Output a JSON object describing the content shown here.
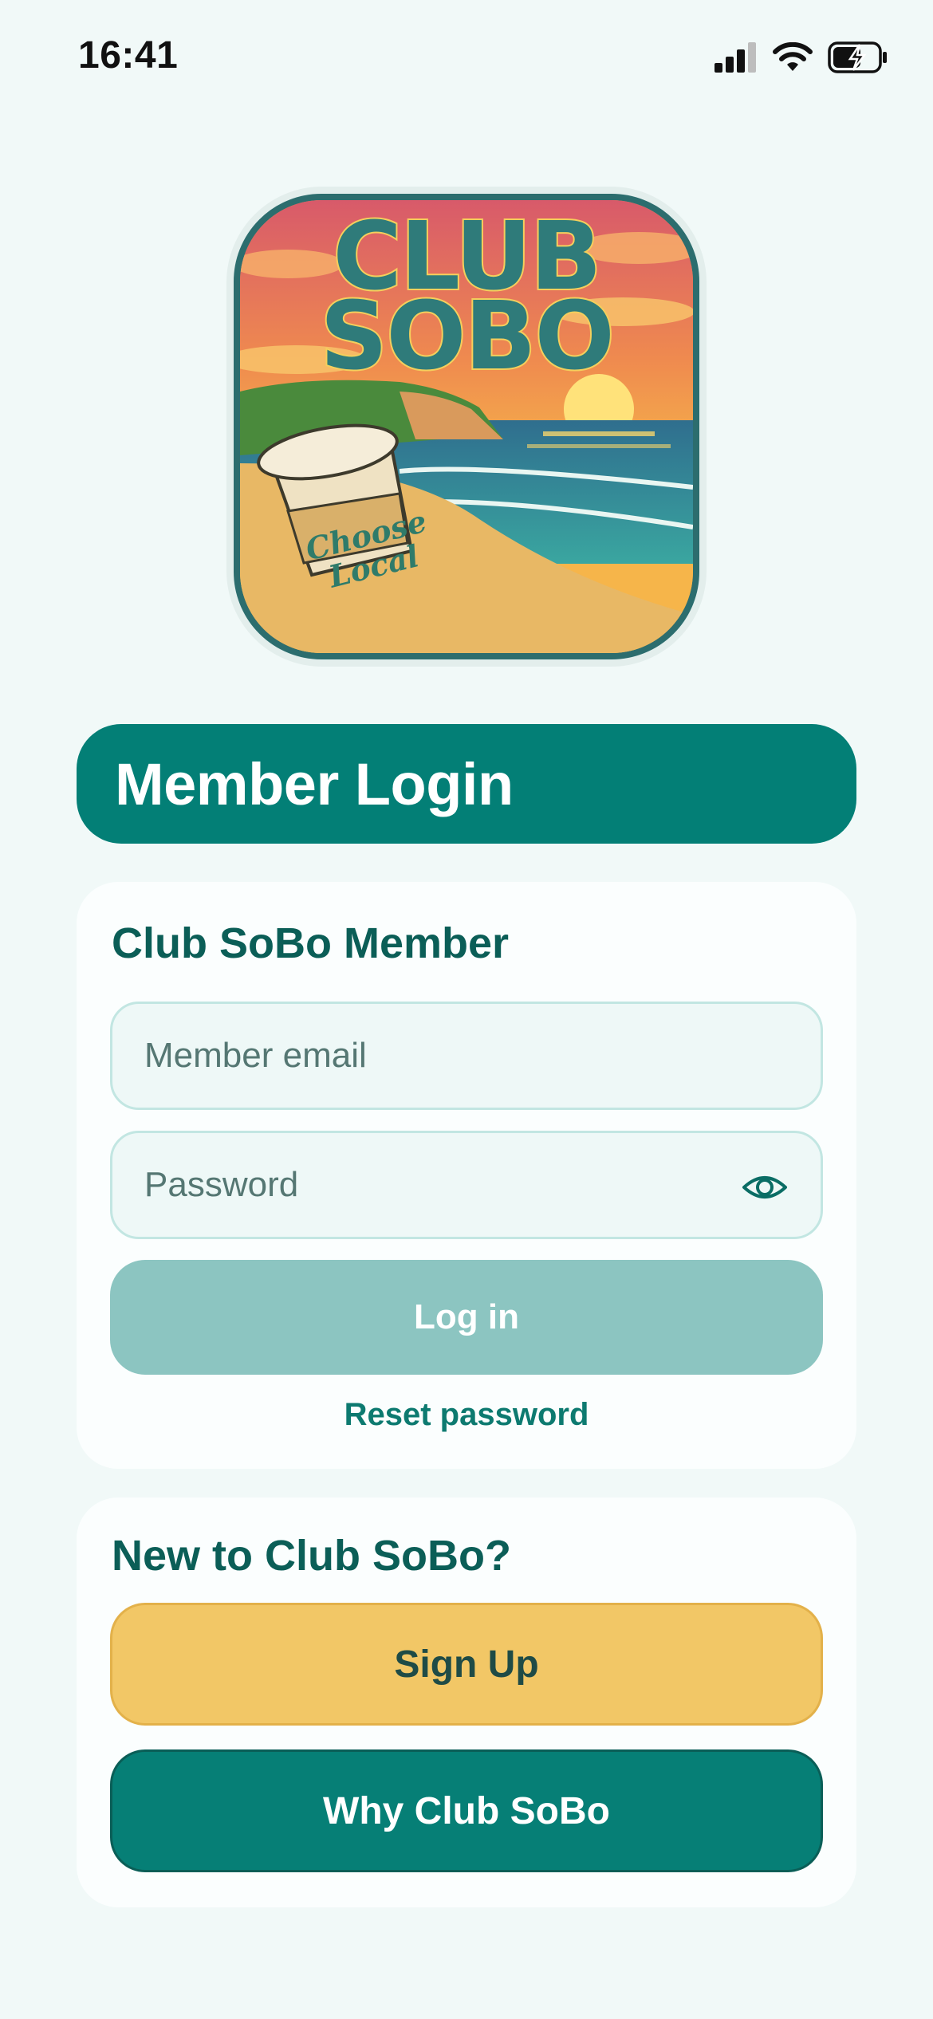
{
  "status_bar": {
    "time": "16:41",
    "icons": [
      "signal-icon",
      "wifi-icon",
      "battery-charging-icon"
    ]
  },
  "logo": {
    "title_line1": "CLUB",
    "title_line2": "SOBO",
    "cup_text": "Choose Local"
  },
  "banner": {
    "title": "Member Login"
  },
  "login_card": {
    "heading": "Club SoBo Member",
    "email_placeholder": "Member email",
    "password_placeholder": "Password",
    "login_button": "Log in",
    "reset_link": "Reset password"
  },
  "signup_card": {
    "heading": "New to Club SoBo?",
    "signup_button": "Sign Up",
    "why_button": "Why Club SoBo"
  },
  "colors": {
    "background": "#f1f9f8",
    "primary": "#037f76",
    "login_disabled": "#8cc5c1",
    "signup": "#f2c766",
    "heading": "#0b5e57"
  }
}
